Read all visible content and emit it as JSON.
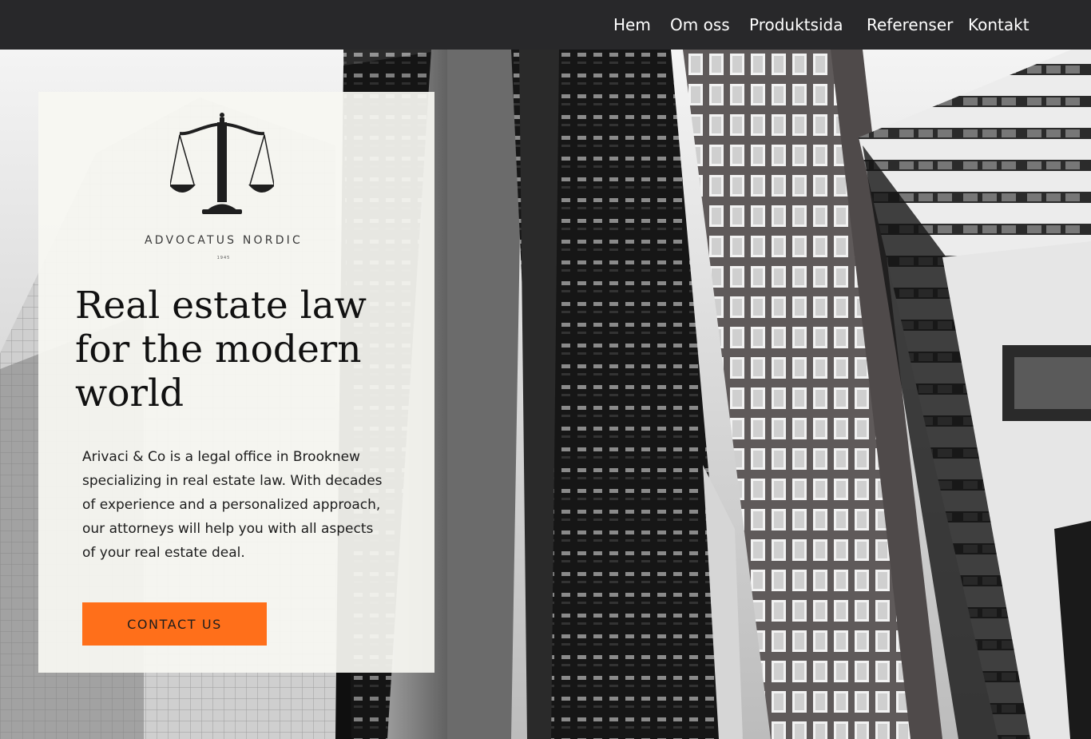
{
  "nav": {
    "items": [
      {
        "label": "Hem"
      },
      {
        "label": "Om oss"
      },
      {
        "label": "Produktsida"
      },
      {
        "label": "Referenser"
      },
      {
        "label": "Kontakt"
      }
    ]
  },
  "hero": {
    "brand_name": "ADVOCATUS NORDIC",
    "brand_year": "1945",
    "logo_icon": "scales-of-justice-icon",
    "headline": "Real estate law for the modern world",
    "description": "Arivaci & Co is a legal office in Brooknew specializing in real estate law. With decades of experience and a personalized approach, our attorneys will help you with all aspects of your real estate deal.",
    "cta_label": "CONTACT US"
  },
  "colors": {
    "nav_background": "#28282a",
    "nav_text": "#ffffff",
    "card_background": "#f8f7f2",
    "accent": "#ff6f1a",
    "headline_text": "#111111"
  }
}
